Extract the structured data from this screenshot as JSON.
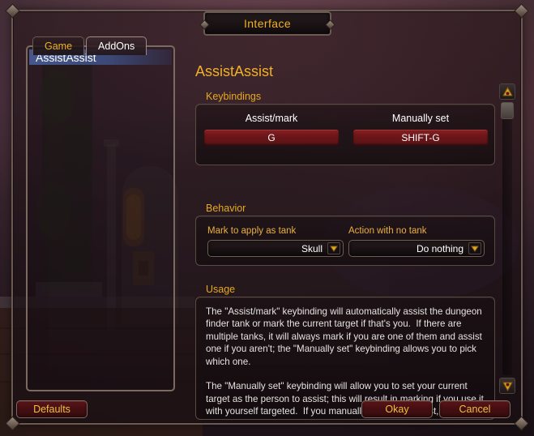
{
  "window": {
    "title": "Interface"
  },
  "tabs": [
    {
      "label": "Game",
      "active": false
    },
    {
      "label": "AddOns",
      "active": true
    }
  ],
  "sidebar": {
    "items": [
      {
        "label": "AssistAssist",
        "selected": true
      }
    ]
  },
  "addon": {
    "title": "AssistAssist",
    "keybindings": {
      "section_label": "Keybindings",
      "entries": [
        {
          "caption": "Assist/mark",
          "key": "G"
        },
        {
          "caption": "Manually set",
          "key": "SHIFT-G"
        }
      ]
    },
    "behavior": {
      "section_label": "Behavior",
      "dropdowns": [
        {
          "caption": "Mark to apply as tank",
          "value": "Skull"
        },
        {
          "caption": "Action with no tank",
          "value": "Do nothing"
        }
      ]
    },
    "usage": {
      "section_label": "Usage",
      "text": "The \"Assist/mark\" keybinding will automatically assist the dungeon finder tank or mark the current target if that's you.  If there are multiple tanks, it will always mark if you are one of them and assist one if you aren't; the \"Manually set\" keybinding allows you to pick which one.\n\nThe \"Manually set\" keybinding will allow you to set your current target as the person to assist; this will result in marking if you use it with yourself targeted.  If you manually set a tank/assist, it will not automatically update (for example if your tank has dropped and the dungeon finder gets you a new one) until you use it"
    }
  },
  "scrollbar": {
    "up_icon": "scroll-up-arrow-icon",
    "down_icon": "scroll-down-arrow-icon"
  },
  "footer": {
    "defaults_label": "Defaults",
    "okay_label": "Okay",
    "cancel_label": "Cancel"
  },
  "colors": {
    "gold": "#f0b028",
    "section_gold": "#e8a820",
    "keybind_red": "#6d1619",
    "button_red": "#450f12",
    "selection_blue": "#485c94",
    "text_white": "#ffffff"
  }
}
